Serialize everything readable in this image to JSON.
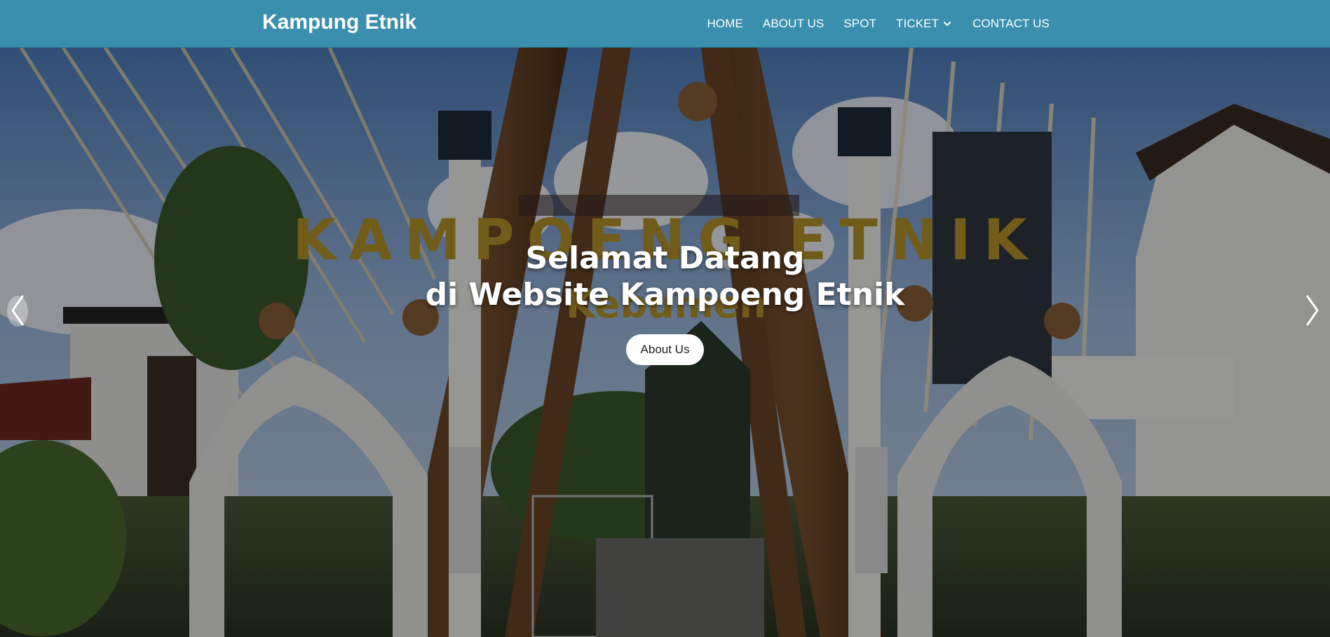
{
  "navbar": {
    "brand": "Kampung Etnik",
    "links": [
      {
        "label": "HOME"
      },
      {
        "label": "ABOUT US"
      },
      {
        "label": "SPOT"
      },
      {
        "label": "TICKET"
      },
      {
        "label": "CONTACT US"
      }
    ],
    "dropdown_icon": "chevron-down-icon"
  },
  "hero": {
    "title_line1": "Selamat Datang",
    "title_line2": "di Website Kampoeng Etnik",
    "button_label": "About Us",
    "prev_icon": "chevron-left-icon",
    "next_icon": "chevron-right-icon",
    "sign_text": "KAMPOENG ETNIK",
    "sign_subtext": "Kebumen"
  },
  "colors": {
    "navbar_bg": "#3a8fae",
    "text_light": "#ffffff"
  }
}
